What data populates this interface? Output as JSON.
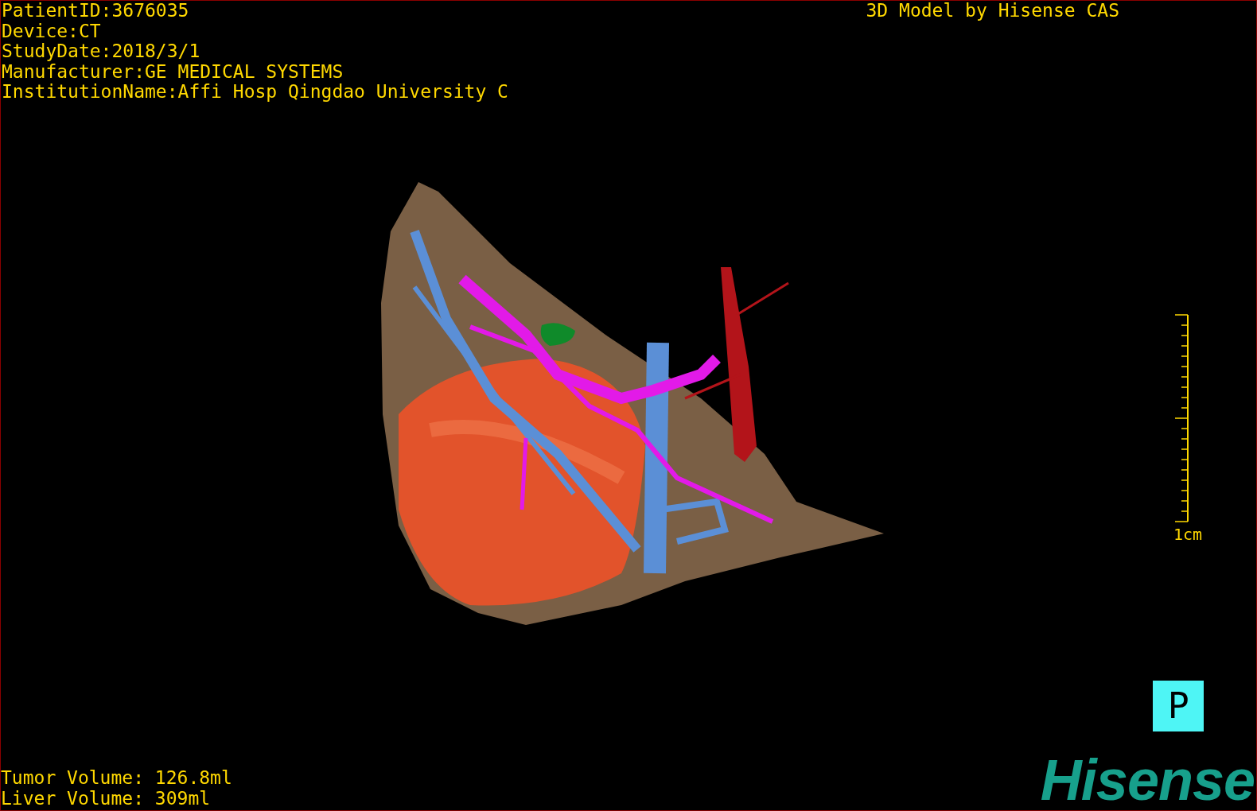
{
  "patient_info": [
    "PatientID:3676035",
    "Device:CT",
    "StudyDate:2018/3/1",
    "Manufacturer:GE MEDICAL SYSTEMS",
    "InstitutionName:Affi Hosp Qingdao University C"
  ],
  "title": "3D Model by Hisense CAS",
  "scale": {
    "label": "1cm"
  },
  "orientation_marker": "P",
  "volumes": [
    "Tumor Volume: 126.8ml",
    "Liver Volume: 309ml"
  ],
  "logo": "Hisense"
}
